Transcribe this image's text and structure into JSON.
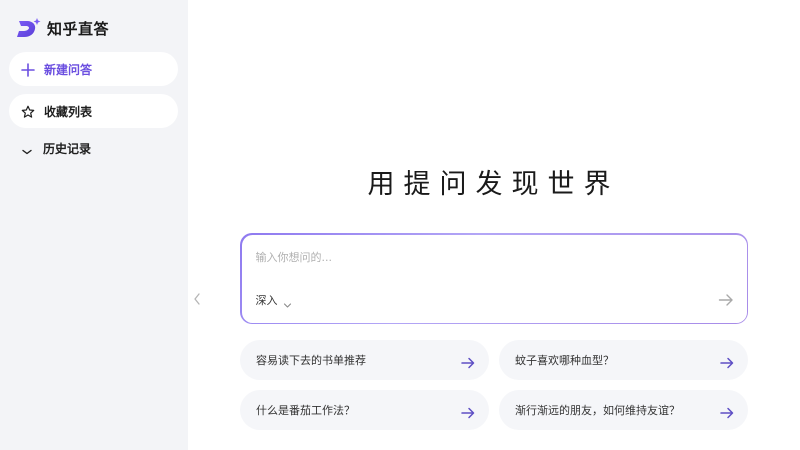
{
  "brand": {
    "name": "知乎直答",
    "logo": "zhida-logo-icon",
    "accent": "#6b4fe0"
  },
  "sidebar": {
    "new_question": {
      "label": "新建问答",
      "icon": "plus-icon"
    },
    "favorites": {
      "label": "收藏列表",
      "icon": "star-icon"
    },
    "history": {
      "label": "历史记录",
      "icon": "chevron-down-icon"
    }
  },
  "main": {
    "title": "用提问发现世界",
    "input": {
      "placeholder": "输入你想问的...",
      "value": ""
    },
    "mode": {
      "label": "深入",
      "icon": "chevron-down-icon"
    },
    "send": {
      "icon": "arrow-right-icon"
    },
    "suggestions": [
      {
        "label": "容易读下去的书单推荐"
      },
      {
        "label": "蚊子喜欢哪种血型？"
      },
      {
        "label": "什么是番茄工作法？"
      },
      {
        "label": "渐行渐远的朋友，如何维持友谊？"
      }
    ]
  }
}
